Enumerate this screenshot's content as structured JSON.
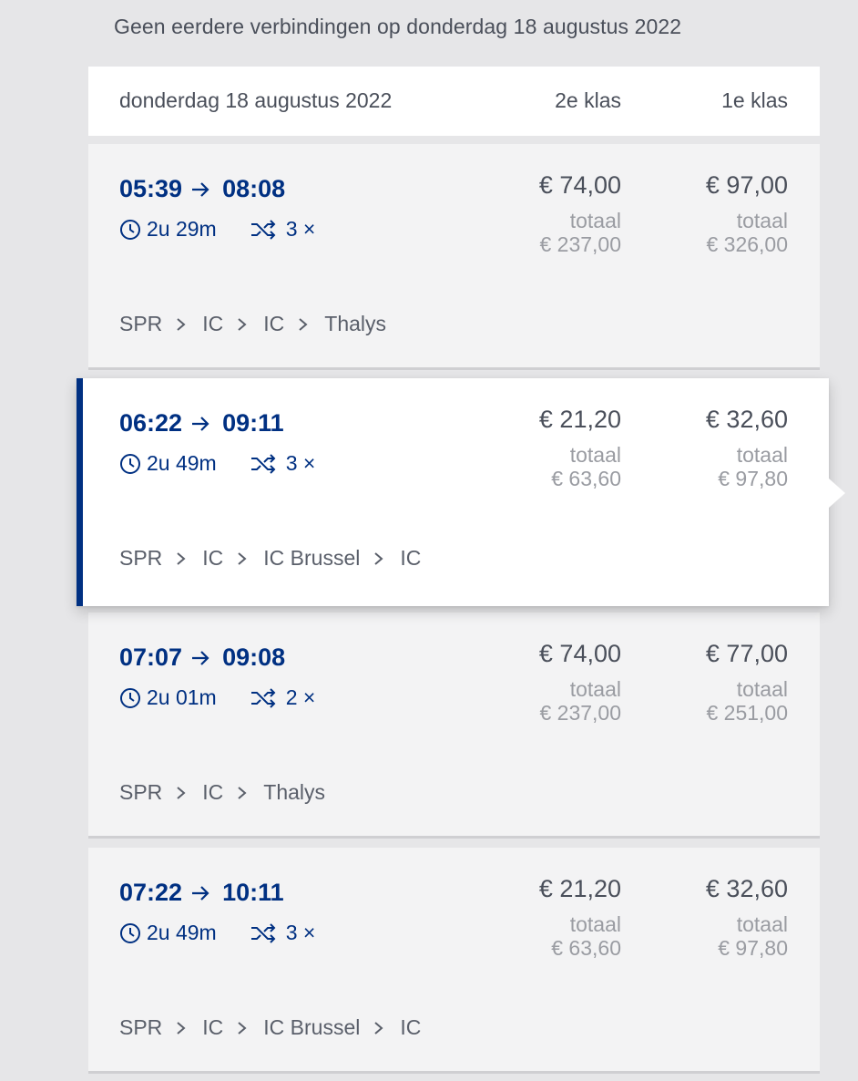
{
  "notice": "Geen eerdere verbindingen op donderdag 18 augustus 2022",
  "header": {
    "date": "donderdag 18 augustus 2022",
    "class2": "2e klas",
    "class1": "1e klas"
  },
  "colors": {
    "accent": "#003082",
    "background": "#e6e6e8"
  },
  "trips": [
    {
      "departure": "05:39",
      "arrival": "08:08",
      "duration": "2u 29m",
      "transfers": "3 ×",
      "price2": "€ 74,00",
      "total_label2": "totaal",
      "total2": "€ 237,00",
      "price1": "€ 97,00",
      "total_label1": "totaal",
      "total1": "€ 326,00",
      "route": [
        "SPR",
        "IC",
        "IC",
        "Thalys"
      ],
      "selected": false
    },
    {
      "departure": "06:22",
      "arrival": "09:11",
      "duration": "2u 49m",
      "transfers": "3 ×",
      "price2": "€ 21,20",
      "total_label2": "totaal",
      "total2": "€ 63,60",
      "price1": "€ 32,60",
      "total_label1": "totaal",
      "total1": "€ 97,80",
      "route": [
        "SPR",
        "IC",
        "IC Brussel",
        "IC"
      ],
      "selected": true
    },
    {
      "departure": "07:07",
      "arrival": "09:08",
      "duration": "2u 01m",
      "transfers": "2 ×",
      "price2": "€ 74,00",
      "total_label2": "totaal",
      "total2": "€ 237,00",
      "price1": "€ 77,00",
      "total_label1": "totaal",
      "total1": "€ 251,00",
      "route": [
        "SPR",
        "IC",
        "Thalys"
      ],
      "selected": false
    },
    {
      "departure": "07:22",
      "arrival": "10:11",
      "duration": "2u 49m",
      "transfers": "3 ×",
      "price2": "€ 21,20",
      "total_label2": "totaal",
      "total2": "€ 63,60",
      "price1": "€ 32,60",
      "total_label1": "totaal",
      "total1": "€ 97,80",
      "route": [
        "SPR",
        "IC",
        "IC Brussel",
        "IC"
      ],
      "selected": false
    }
  ]
}
